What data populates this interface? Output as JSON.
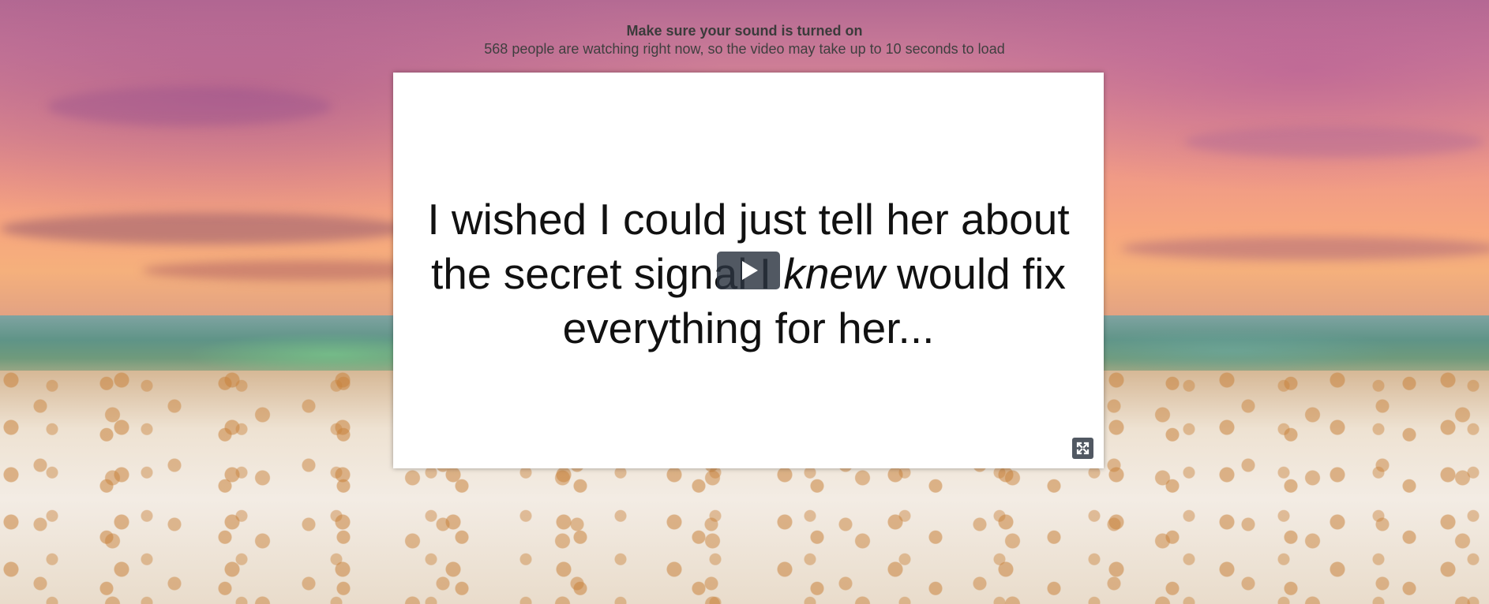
{
  "notice": {
    "title": "Make sure your sound is turned on",
    "subtitle": "568 people are watching right now, so the video may take up to 10 seconds to load"
  },
  "video": {
    "caption_part1": "I wished I could just tell her about the secret signal I ",
    "caption_emphasis": "knew",
    "caption_part2": " would fix everything for her...",
    "play_icon": "play-icon",
    "fullscreen_icon": "fullscreen-icon"
  },
  "colors": {
    "player_background": "#ffffff",
    "control_background": "#2b333f",
    "text": "#111111"
  }
}
